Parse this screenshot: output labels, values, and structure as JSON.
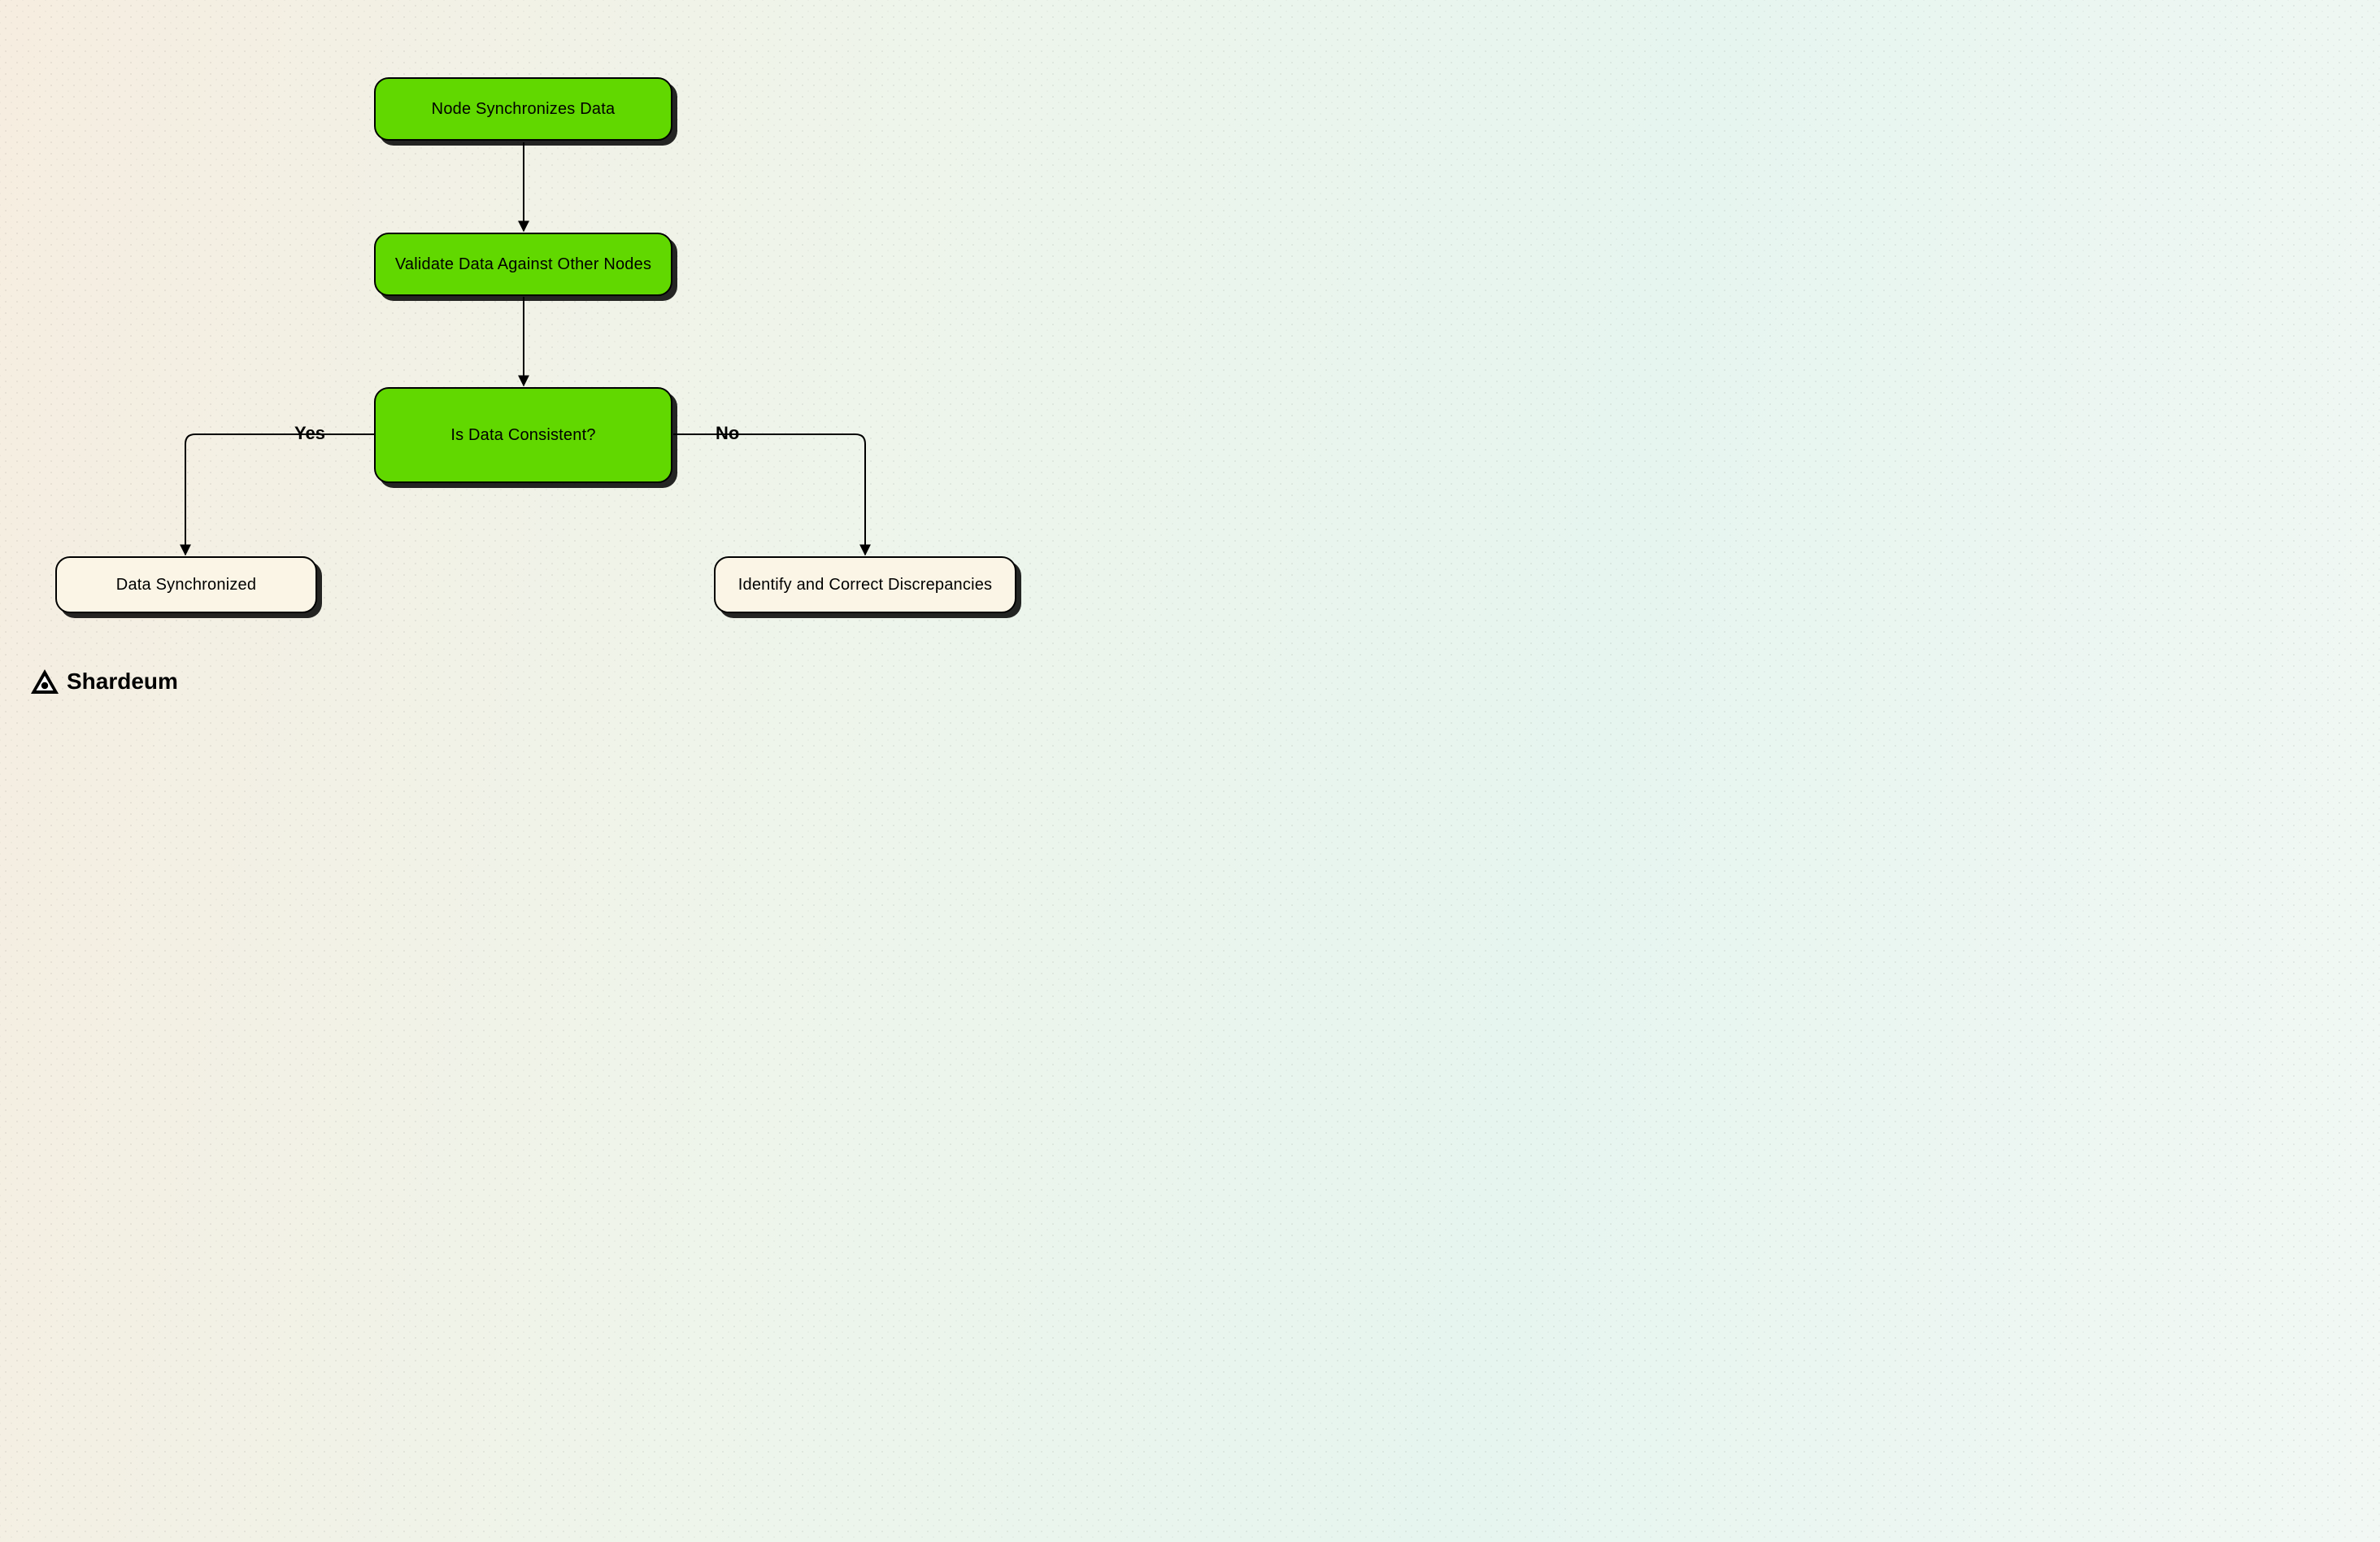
{
  "nodes": {
    "sync": "Node Synchronizes Data",
    "validate": "Validate Data Against Other Nodes",
    "decision": "Is Data Consistent?",
    "yes_result": "Data Synchronized",
    "no_result": "Identify and Correct Discrepancies"
  },
  "edges": {
    "yes_label": "Yes",
    "no_label": "No"
  },
  "brand": {
    "name": "Shardeum"
  },
  "colors": {
    "process_fill": "#61d800",
    "terminal_fill": "#fbf5e6",
    "stroke": "#000000"
  },
  "chart_data": {
    "type": "flowchart",
    "title": "",
    "nodes": [
      {
        "id": "n1",
        "label": "Node Synchronizes Data",
        "kind": "process",
        "fill": "#61d800"
      },
      {
        "id": "n2",
        "label": "Validate Data Against Other Nodes",
        "kind": "process",
        "fill": "#61d800"
      },
      {
        "id": "n3",
        "label": "Is Data Consistent?",
        "kind": "decision",
        "fill": "#61d800"
      },
      {
        "id": "n4",
        "label": "Data Synchronized",
        "kind": "terminal",
        "fill": "#fbf5e6"
      },
      {
        "id": "n5",
        "label": "Identify and Correct Discrepancies",
        "kind": "terminal",
        "fill": "#fbf5e6"
      }
    ],
    "edges": [
      {
        "from": "n1",
        "to": "n2",
        "label": ""
      },
      {
        "from": "n2",
        "to": "n3",
        "label": ""
      },
      {
        "from": "n3",
        "to": "n4",
        "label": "Yes"
      },
      {
        "from": "n3",
        "to": "n5",
        "label": "No"
      }
    ]
  }
}
